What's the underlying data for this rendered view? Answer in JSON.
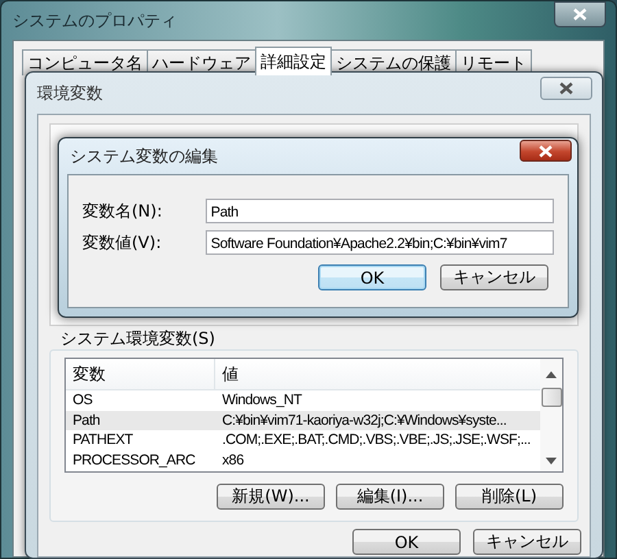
{
  "window": {
    "title": "システムのプロパティ"
  },
  "tabs": [
    {
      "label": "コンピュータ名",
      "selected": false
    },
    {
      "label": "ハードウェア",
      "selected": false
    },
    {
      "label": "詳細設定",
      "selected": true
    },
    {
      "label": "システムの保護",
      "selected": false
    },
    {
      "label": "リモート",
      "selected": false
    }
  ],
  "env_dialog": {
    "title": "環境変数",
    "system_variables": {
      "label": "システム環境変数(S)",
      "columns": [
        "変数",
        "値"
      ],
      "rows": [
        {
          "name": "OS",
          "value": "Windows_NT",
          "selected": false
        },
        {
          "name": "Path",
          "value": "C:¥bin¥vim71-kaoriya-w32j;C:¥Windows¥syste...",
          "selected": true
        },
        {
          "name": "PATHEXT",
          "value": ".COM;.EXE;.BAT;.CMD;.VBS;.VBE;.JS;.JSE;.WSF;...",
          "selected": false
        },
        {
          "name": "PROCESSOR_ARC",
          "value": "x86",
          "selected": false
        }
      ],
      "buttons": [
        "新規(W)...",
        "編集(I)...",
        "削除(L)"
      ]
    },
    "buttons": [
      {
        "label": "OK",
        "default": false
      },
      {
        "label": "キャンセル",
        "default": false
      }
    ]
  },
  "edit_dialog": {
    "title": "システム変数の編集",
    "fields": [
      {
        "label": "変数名(N):",
        "value": "Path"
      },
      {
        "label": "変数値(V):",
        "value": "Software Foundation¥Apache2.2¥bin;C:¥bin¥vim7"
      }
    ],
    "buttons": [
      {
        "label": "OK",
        "default": true
      },
      {
        "label": "キャンセル",
        "default": false
      }
    ]
  }
}
